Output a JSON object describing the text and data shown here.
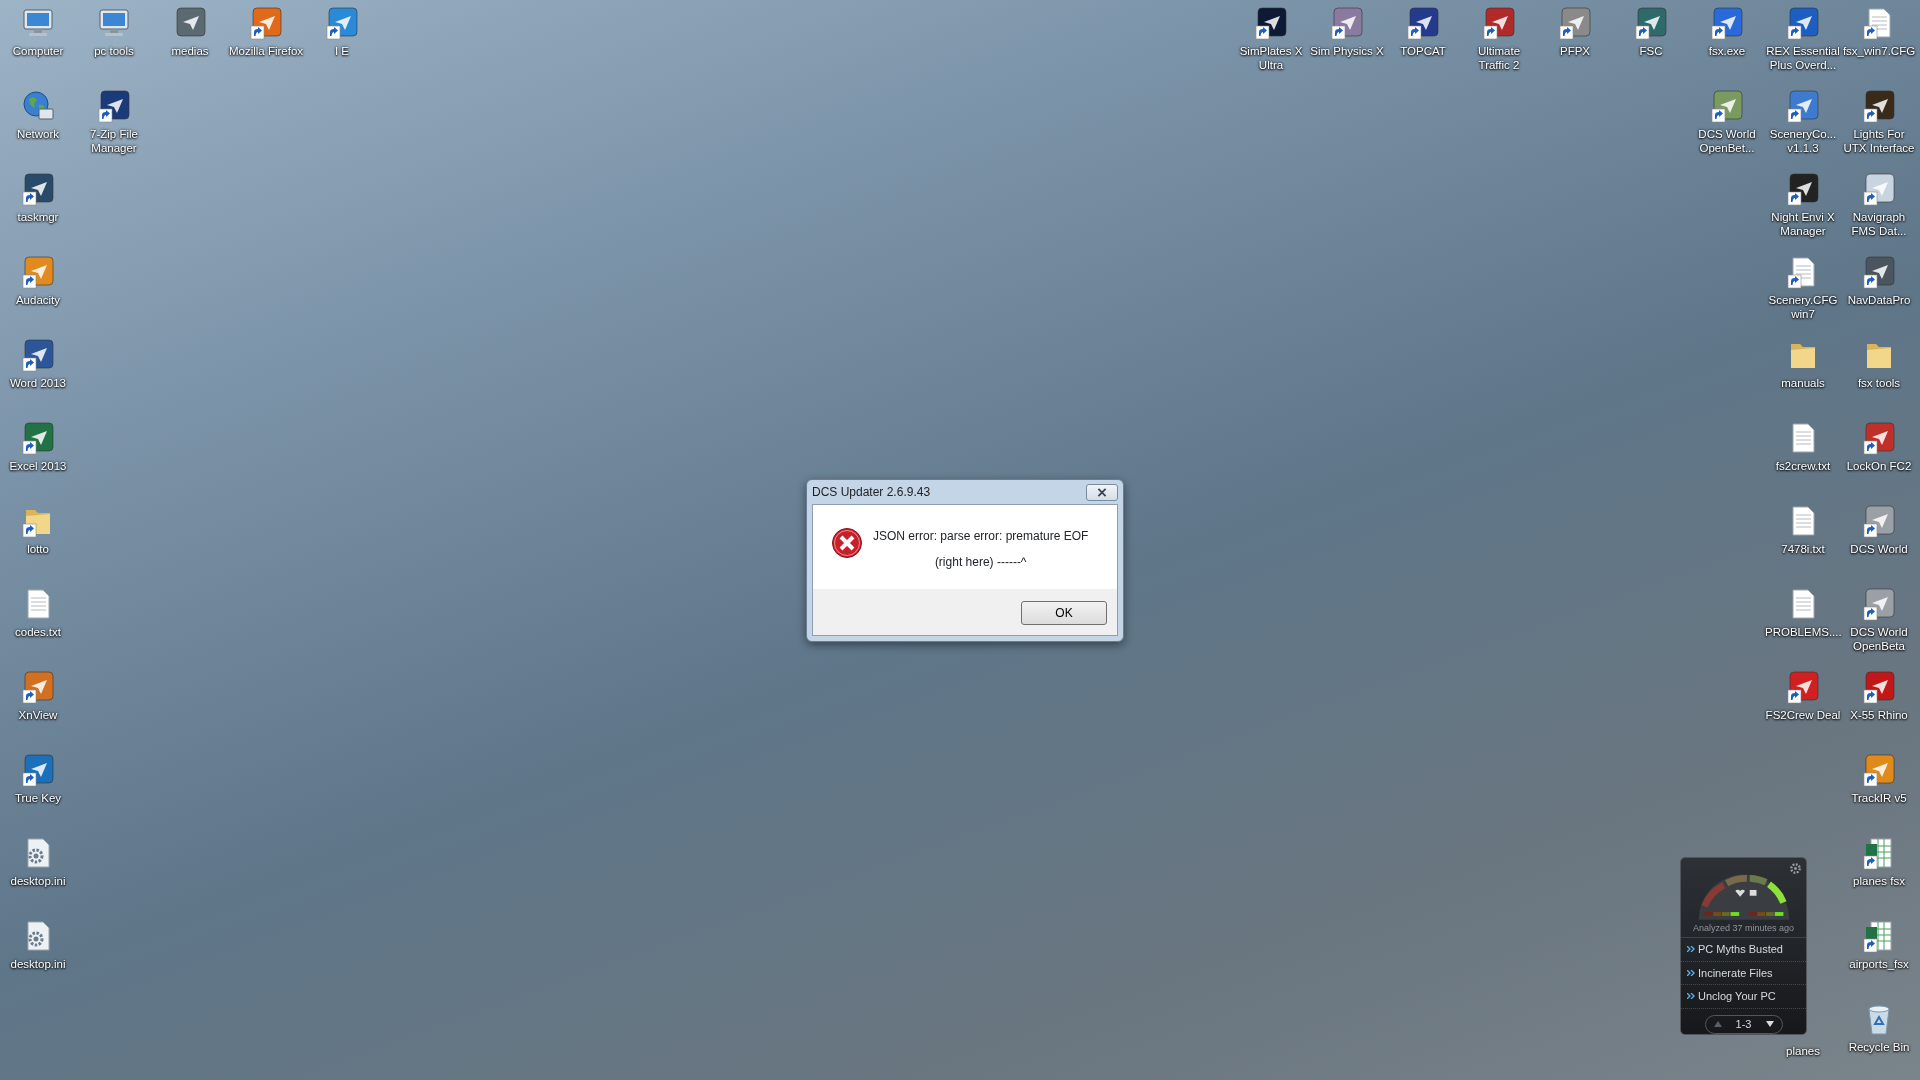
{
  "desktop": {
    "left_columns": [
      [
        {
          "label": "Computer",
          "kind": "computer",
          "shortcut": false
        },
        {
          "label": "Network",
          "kind": "network",
          "shortcut": false
        },
        {
          "label": "taskmgr",
          "kind": "app",
          "color": "#2a4a6a",
          "shortcut": true
        },
        {
          "label": "Audacity",
          "kind": "app",
          "color": "#e08a20",
          "shortcut": true
        },
        {
          "label": "Word 2013",
          "kind": "app",
          "color": "#2b579a",
          "shortcut": true
        },
        {
          "label": "Excel 2013",
          "kind": "app",
          "color": "#217346",
          "shortcut": true
        },
        {
          "label": "lotto",
          "kind": "folder",
          "shortcut": true
        },
        {
          "label": "codes.txt",
          "kind": "text",
          "shortcut": false
        },
        {
          "label": "XnView",
          "kind": "app",
          "color": "#d07020",
          "shortcut": true
        },
        {
          "label": "True Key",
          "kind": "app",
          "color": "#1c6fb8",
          "shortcut": true
        },
        {
          "label": "desktop.ini",
          "kind": "settings",
          "shortcut": false
        },
        {
          "label": "desktop.ini",
          "kind": "settings",
          "shortcut": false
        }
      ],
      [
        {
          "label": "pc tools",
          "kind": "computer",
          "shortcut": false
        },
        {
          "label": "7-Zip File Manager",
          "kind": "app",
          "color": "#1a3a7a",
          "shortcut": true
        }
      ],
      [
        {
          "label": "medias",
          "kind": "app",
          "color": "#5a6a70",
          "shortcut": false
        }
      ],
      [
        {
          "label": "Mozilla Firefox",
          "kind": "app",
          "color": "#e06a1a",
          "shortcut": true
        }
      ],
      [
        {
          "label": "I E",
          "kind": "app",
          "color": "#2a8ad8",
          "shortcut": true
        }
      ]
    ],
    "right_columns": [
      [
        {
          "label": "SimPlates X Ultra",
          "kind": "app",
          "color": "#0e1a35",
          "shortcut": true
        }
      ],
      [
        {
          "label": "Sim Physics X",
          "kind": "app",
          "color": "#8a7aa0",
          "shortcut": true
        }
      ],
      [
        {
          "label": "TOPCAT",
          "kind": "app",
          "color": "#243a8c",
          "shortcut": true
        }
      ],
      [
        {
          "label": "Ultimate Traffic 2",
          "kind": "app",
          "color": "#b02a2a",
          "shortcut": true
        }
      ],
      [
        {
          "label": "PFPX",
          "kind": "app",
          "color": "#8a8a8a",
          "shortcut": true
        }
      ],
      [
        {
          "label": "FSC",
          "kind": "app",
          "color": "#2e6a6a",
          "shortcut": true
        }
      ],
      [
        {
          "label": "fsx.exe",
          "kind": "app",
          "color": "#2a6ad8",
          "shortcut": true
        },
        {
          "label": "DCS World OpenBet...",
          "kind": "app",
          "color": "#7a9a60",
          "shortcut": true
        }
      ],
      [
        {
          "label": "REX Essential Plus Overd...",
          "kind": "app",
          "color": "#1d5fc0",
          "shortcut": true
        },
        {
          "label": "SceneryCo... v1.1.3",
          "kind": "app",
          "color": "#3c7bd0",
          "shortcut": true
        },
        {
          "label": "Night Envi X Manager",
          "kind": "app",
          "color": "#222222",
          "shortcut": true
        },
        {
          "label": "Scenery.CFG win7",
          "kind": "text",
          "shortcut": true
        },
        {
          "label": "manuals",
          "kind": "folder",
          "shortcut": false
        },
        {
          "label": "fs2crew.txt",
          "kind": "text",
          "shortcut": false
        },
        {
          "label": "7478i.txt",
          "kind": "text",
          "shortcut": false
        },
        {
          "label": "PROBLEMS....",
          "kind": "text",
          "shortcut": false
        },
        {
          "label": "FS2Crew Deal",
          "kind": "app",
          "color": "#d02020",
          "shortcut": true
        }
      ],
      [
        {
          "label": "fsx_win7.CFG",
          "kind": "text",
          "shortcut": true
        },
        {
          "label": "Lights For UTX Interface",
          "kind": "app",
          "color": "#3a2a1a",
          "shortcut": true
        },
        {
          "label": "Navigraph FMS Dat...",
          "kind": "app",
          "color": "#c8d4e0",
          "shortcut": true
        },
        {
          "label": "NavDataPro",
          "kind": "app",
          "color": "#4a5560",
          "shortcut": true
        },
        {
          "label": "fsx tools",
          "kind": "folder",
          "shortcut": false
        },
        {
          "label": "LockOn FC2",
          "kind": "app",
          "color": "#c0302a",
          "shortcut": true
        },
        {
          "label": "DCS World",
          "kind": "app",
          "color": "#9aa0a6",
          "shortcut": true
        },
        {
          "label": "DCS World OpenBeta",
          "kind": "app",
          "color": "#9aa0a6",
          "shortcut": true
        },
        {
          "label": "X-55 Rhino",
          "kind": "app",
          "color": "#c01818",
          "shortcut": true
        },
        {
          "label": "TrackIR v5",
          "kind": "app",
          "color": "#e08a1a",
          "shortcut": true
        },
        {
          "label": "planes fsx",
          "kind": "spreadsheet",
          "shortcut": true
        },
        {
          "label": "airports_fsx",
          "kind": "spreadsheet",
          "shortcut": true
        },
        {
          "label": "Recycle Bin",
          "kind": "recycle",
          "shortcut": false
        }
      ]
    ],
    "covered_icon_label": "planes"
  },
  "dialog": {
    "title": "DCS Updater 2.6.9.43",
    "message": "JSON error: parse error: premature EOF",
    "detail": "(right here) ------^",
    "button": "OK"
  },
  "widget": {
    "status": "Analyzed 37 minutes ago",
    "links": [
      "PC Myths Busted",
      "Incinerate Files",
      "Unclog Your PC"
    ],
    "pager": "1-3"
  }
}
